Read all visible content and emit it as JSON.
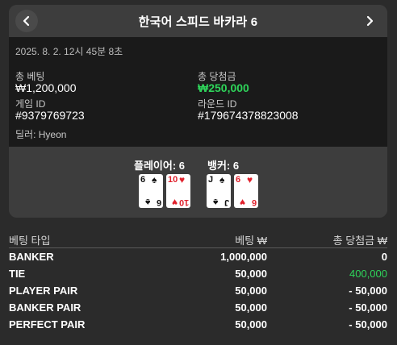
{
  "header": {
    "title": "한국어 스피드 바카라 6",
    "prev_icon": "chevron-left-icon",
    "next_icon": "chevron-right-icon"
  },
  "info": {
    "datetime": "2025. 8. 2. 12시 45분 8초",
    "total_bet_label": "총 베팅",
    "total_bet_value": "₩1,200,000",
    "total_win_label": "총 당첨금",
    "total_win_value": "₩250,000",
    "game_id_label": "게임 ID",
    "game_id_value": "#9379769723",
    "round_id_label": "라운드 ID",
    "round_id_value": "#179674378823008",
    "dealer": "딜러: Hyeon"
  },
  "result": {
    "player_label": "플레이어: 6",
    "banker_label": "뱅커: 6",
    "player_cards": [
      {
        "rank": "6",
        "suit": "♠",
        "color": "black"
      },
      {
        "rank": "10",
        "suit": "♥",
        "color": "red"
      }
    ],
    "banker_cards": [
      {
        "rank": "J",
        "suit": "♠",
        "color": "black"
      },
      {
        "rank": "6",
        "suit": "♥",
        "color": "red"
      }
    ]
  },
  "bets": {
    "headers": [
      "베팅 타입",
      "베팅 ₩",
      "총 당첨금 ₩"
    ],
    "rows": [
      {
        "type": "BANKER",
        "bet": "1,000,000",
        "win": "0"
      },
      {
        "type": "TIE",
        "bet": "50,000",
        "win": "400,000"
      },
      {
        "type": "PLAYER PAIR",
        "bet": "50,000",
        "win": "- 50,000"
      },
      {
        "type": "BANKER PAIR",
        "bet": "50,000",
        "win": "- 50,000"
      },
      {
        "type": "PERFECT PAIR",
        "bet": "50,000",
        "win": "- 50,000"
      }
    ]
  },
  "colors": {
    "win_green": "#2ed45a",
    "card_red": "#e0212c",
    "panel": "#3d3d3d",
    "info_bg": "#1a1a1a",
    "page_bg": "#2b2b2b"
  }
}
